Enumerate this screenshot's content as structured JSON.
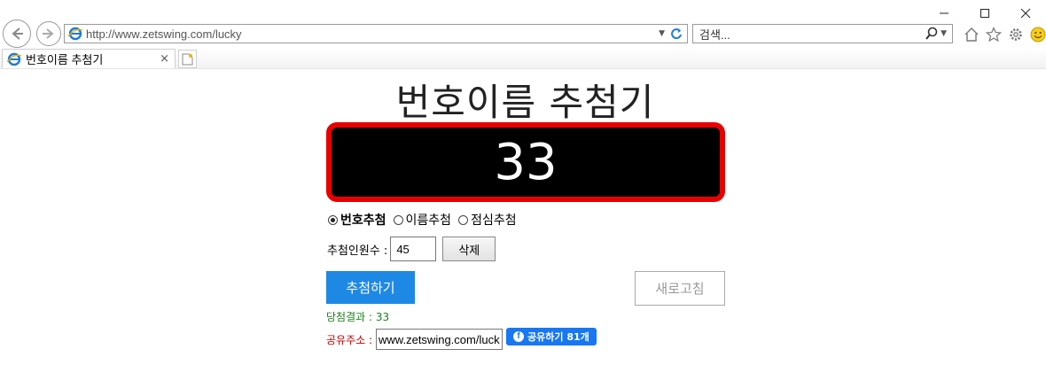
{
  "browser": {
    "url": "http://www.zetswing.com/lucky",
    "search_placeholder": "검색...",
    "tab_title": "번호이름 추첨기",
    "tab_close": "×",
    "accent_color": "#1e88e5"
  },
  "page": {
    "title": "번호이름 추첨기",
    "display_number": "33",
    "modes": [
      {
        "label": "번호추첨",
        "selected": true
      },
      {
        "label": "이름추첨",
        "selected": false
      },
      {
        "label": "점심추첨",
        "selected": false
      }
    ],
    "count_label": "추첨인원수 :",
    "count_value": "45",
    "delete_label": "삭제",
    "draw_label": "추첨하기",
    "refresh_label": "새로고침",
    "result_text": "당첨결과 : 33",
    "share_label": "공유주소 :",
    "share_url": "www.zetswing.com/lucky",
    "fb_share_label": "공유하기 81개"
  }
}
